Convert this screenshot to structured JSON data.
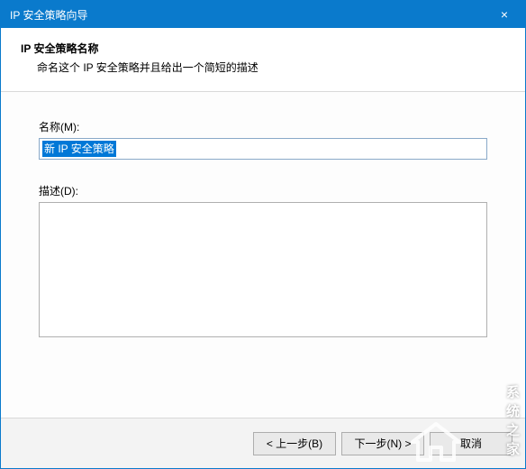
{
  "titlebar": {
    "title": "IP 安全策略向导",
    "close": "×"
  },
  "header": {
    "title": "IP 安全策略名称",
    "sub": "命名这个 IP 安全策略并且给出一个简短的描述"
  },
  "form": {
    "name_label": "名称(M):",
    "name_value": "新 IP 安全策略",
    "desc_label": "描述(D):",
    "desc_value": ""
  },
  "footer": {
    "back": "< 上一步(B)",
    "next": "下一步(N) >",
    "cancel": "取消"
  },
  "watermark": {
    "text": "系统之家"
  }
}
